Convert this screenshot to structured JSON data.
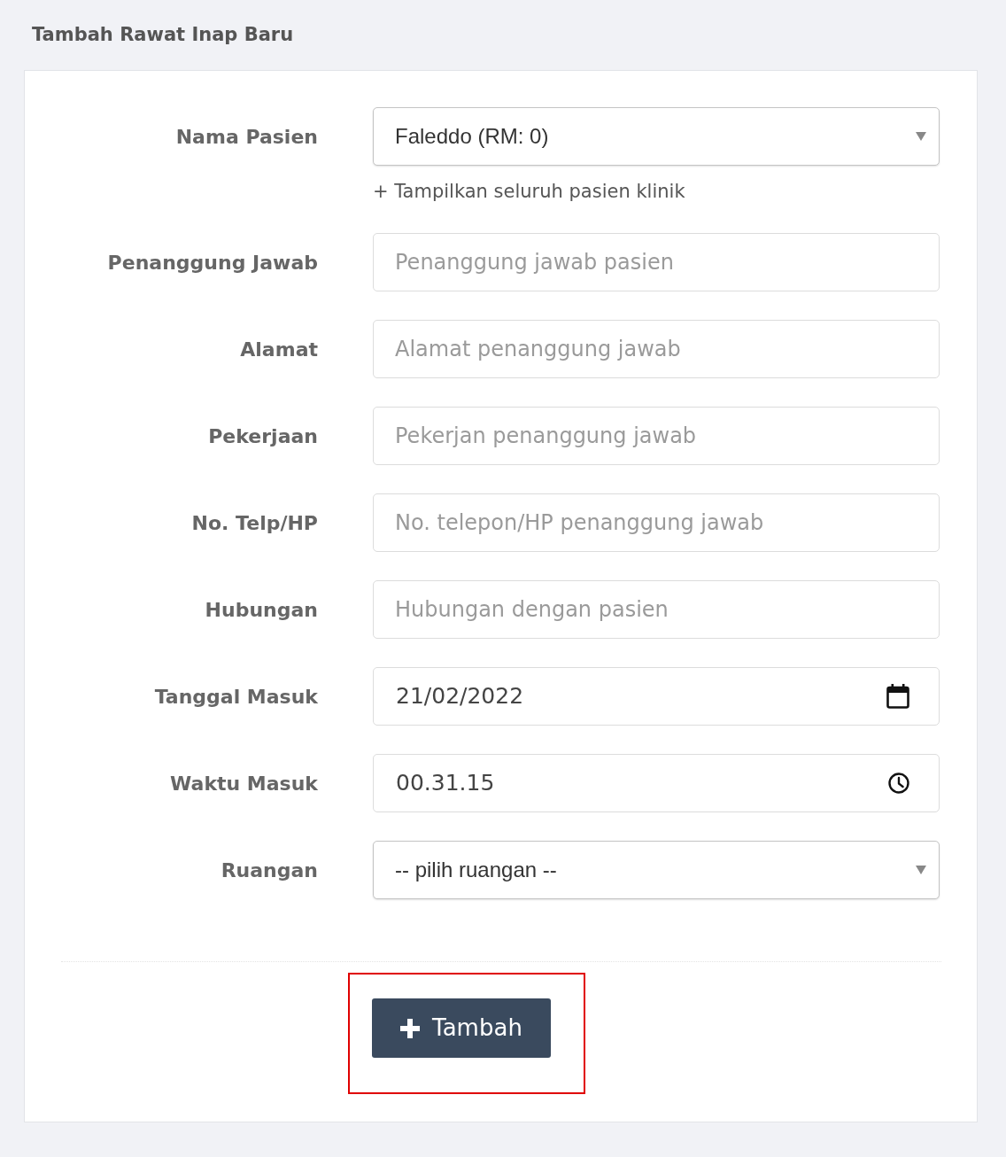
{
  "page_title": "Tambah Rawat Inap Baru",
  "form": {
    "fields": [
      {
        "kind": "select",
        "label": "Nama Pasien",
        "value": "Faleddo (RM: 0)",
        "help_link": "+ Tampilkan seluruh pasien klinik"
      },
      {
        "kind": "text",
        "label": "Penanggung Jawab",
        "placeholder": "Penanggung jawab pasien"
      },
      {
        "kind": "text",
        "label": "Alamat",
        "placeholder": "Alamat penanggung jawab"
      },
      {
        "kind": "text",
        "label": "Pekerjaan",
        "placeholder": "Pekerjan penanggung jawab"
      },
      {
        "kind": "text",
        "label": "No. Telp/HP",
        "placeholder": "No. telepon/HP penanggung jawab"
      },
      {
        "kind": "text",
        "label": "Hubungan",
        "placeholder": "Hubungan dengan pasien"
      },
      {
        "kind": "date",
        "label": "Tanggal Masuk",
        "value": "21/02/2022"
      },
      {
        "kind": "time",
        "label": "Waktu Masuk",
        "value": "00.31.15"
      },
      {
        "kind": "select",
        "label": "Ruangan",
        "value": "-- pilih ruangan --"
      }
    ]
  },
  "submit_button": {
    "label": "Tambah",
    "highlighted": true
  }
}
